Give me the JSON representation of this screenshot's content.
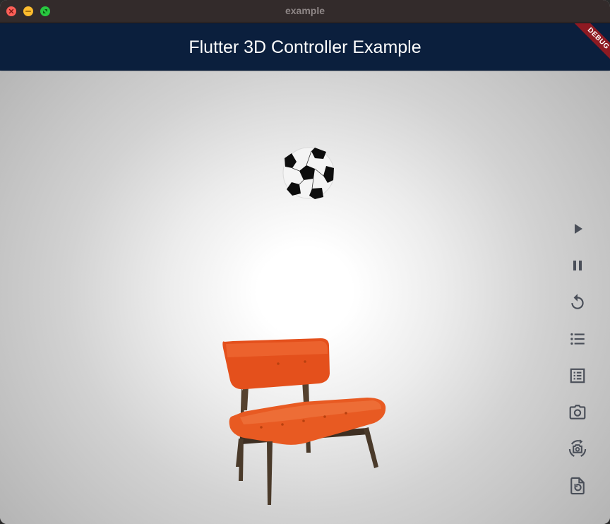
{
  "window": {
    "title": "example",
    "buttons": [
      "close",
      "minimize",
      "fullscreen"
    ]
  },
  "appbar": {
    "title": "Flutter 3D Controller Example",
    "color": "#0b1f3d"
  },
  "debug_banner": {
    "label": "DEBUG",
    "color": "#8e1a22"
  },
  "viewer": {
    "models": [
      "soccer-ball",
      "orange-chair"
    ]
  },
  "controls": [
    {
      "icon": "play-icon"
    },
    {
      "icon": "pause-icon"
    },
    {
      "icon": "replay-icon"
    },
    {
      "icon": "list-icon"
    },
    {
      "icon": "list-alt-icon"
    },
    {
      "icon": "camera-icon"
    },
    {
      "icon": "camera-rotate-icon"
    },
    {
      "icon": "file-reset-icon"
    }
  ]
}
